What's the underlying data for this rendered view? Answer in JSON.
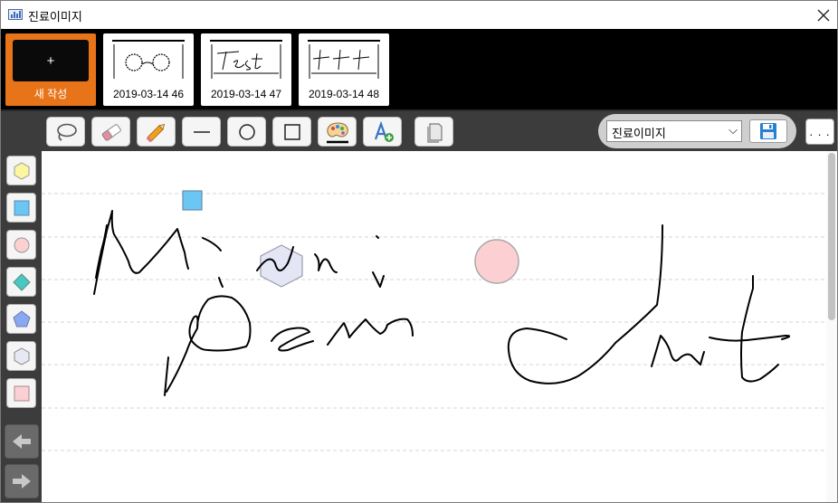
{
  "window": {
    "title": "진료이미지",
    "close_icon": "close-icon"
  },
  "thumbnails": {
    "new_card": {
      "plus": "+",
      "label": "새 작성"
    },
    "items": [
      {
        "caption": "2019-03-14 46"
      },
      {
        "caption": "2019-03-14 47"
      },
      {
        "caption": "2019-03-14 48"
      }
    ]
  },
  "toolbar": {
    "tools": [
      "lasso-icon",
      "eraser-icon",
      "pencil-icon",
      "line-icon",
      "circle-icon",
      "rectangle-icon",
      "palette-icon",
      "text-add-icon",
      "page-icon"
    ],
    "document_select": {
      "value": "진료이미지",
      "chevron": "⌵"
    },
    "save_icon": "floppy-disk-icon",
    "more_label": ". . ."
  },
  "shapes_panel": {
    "shapes": [
      "hexagon-yellow",
      "square-blue",
      "circle-pink",
      "diamond-teal",
      "pentagon-blue",
      "hexagon-gray",
      "square-pink"
    ],
    "nav": [
      "arrow-left-icon",
      "arrow-right-icon"
    ]
  },
  "colors": {
    "accent_orange": "#e8741a",
    "toolbar_bg": "#3c3c3c",
    "canvas_line": "#d8d8d8"
  }
}
